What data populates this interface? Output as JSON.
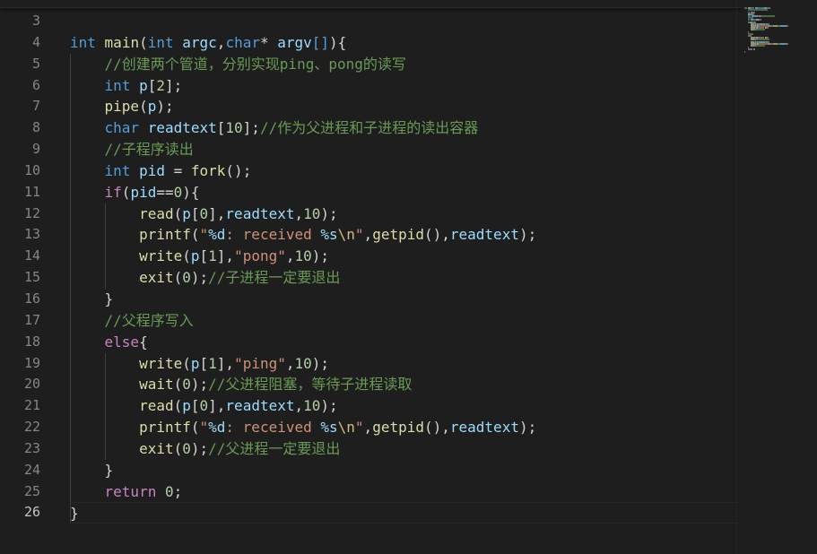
{
  "editor": {
    "active_line": "26",
    "lines": [
      {
        "n": "3",
        "tokens": []
      },
      {
        "n": "4",
        "tokens": [
          {
            "t": "int",
            "c": "kw"
          },
          {
            "t": " ",
            "c": "pl"
          },
          {
            "t": "main",
            "c": "fn"
          },
          {
            "t": "(",
            "c": "pl"
          },
          {
            "t": "int",
            "c": "kw"
          },
          {
            "t": " ",
            "c": "pl"
          },
          {
            "t": "argc",
            "c": "var"
          },
          {
            "t": ",",
            "c": "pl"
          },
          {
            "t": "char",
            "c": "kw"
          },
          {
            "t": "* ",
            "c": "pl"
          },
          {
            "t": "argv",
            "c": "var"
          },
          {
            "t": "[]",
            "c": "kw"
          },
          {
            "t": "){",
            "c": "pl"
          }
        ]
      },
      {
        "n": "5",
        "tokens": [
          {
            "t": "    ",
            "c": "pl"
          },
          {
            "t": "//创建两个管道，分别实现ping、pong的读写",
            "c": "cm"
          }
        ]
      },
      {
        "n": "6",
        "tokens": [
          {
            "t": "    ",
            "c": "pl"
          },
          {
            "t": "int",
            "c": "kw"
          },
          {
            "t": " ",
            "c": "pl"
          },
          {
            "t": "p",
            "c": "var"
          },
          {
            "t": "[",
            "c": "pl"
          },
          {
            "t": "2",
            "c": "num"
          },
          {
            "t": "];",
            "c": "pl"
          }
        ]
      },
      {
        "n": "7",
        "tokens": [
          {
            "t": "    ",
            "c": "pl"
          },
          {
            "t": "pipe",
            "c": "fn"
          },
          {
            "t": "(",
            "c": "pl"
          },
          {
            "t": "p",
            "c": "var"
          },
          {
            "t": ");",
            "c": "pl"
          }
        ]
      },
      {
        "n": "8",
        "tokens": [
          {
            "t": "    ",
            "c": "pl"
          },
          {
            "t": "char",
            "c": "kw"
          },
          {
            "t": " ",
            "c": "pl"
          },
          {
            "t": "readtext",
            "c": "var"
          },
          {
            "t": "[",
            "c": "pl"
          },
          {
            "t": "10",
            "c": "num"
          },
          {
            "t": "];",
            "c": "pl"
          },
          {
            "t": "//作为父进程和子进程的读出容器",
            "c": "cm"
          }
        ]
      },
      {
        "n": "9",
        "tokens": [
          {
            "t": "    ",
            "c": "pl"
          },
          {
            "t": "//子程序读出",
            "c": "cm"
          }
        ]
      },
      {
        "n": "10",
        "tokens": [
          {
            "t": "    ",
            "c": "pl"
          },
          {
            "t": "int",
            "c": "kw"
          },
          {
            "t": " ",
            "c": "pl"
          },
          {
            "t": "pid",
            "c": "var"
          },
          {
            "t": " = ",
            "c": "pl"
          },
          {
            "t": "fork",
            "c": "fn"
          },
          {
            "t": "();",
            "c": "pl"
          }
        ]
      },
      {
        "n": "11",
        "tokens": [
          {
            "t": "    ",
            "c": "pl"
          },
          {
            "t": "if",
            "c": "ctl"
          },
          {
            "t": "(",
            "c": "pl"
          },
          {
            "t": "pid",
            "c": "var"
          },
          {
            "t": "==",
            "c": "pl"
          },
          {
            "t": "0",
            "c": "num"
          },
          {
            "t": "){",
            "c": "pl"
          }
        ]
      },
      {
        "n": "12",
        "tokens": [
          {
            "t": "        ",
            "c": "pl"
          },
          {
            "t": "read",
            "c": "fn"
          },
          {
            "t": "(",
            "c": "pl"
          },
          {
            "t": "p",
            "c": "var"
          },
          {
            "t": "[",
            "c": "pl"
          },
          {
            "t": "0",
            "c": "num"
          },
          {
            "t": "],",
            "c": "pl"
          },
          {
            "t": "readtext",
            "c": "var"
          },
          {
            "t": ",",
            "c": "pl"
          },
          {
            "t": "10",
            "c": "num"
          },
          {
            "t": ");",
            "c": "pl"
          }
        ]
      },
      {
        "n": "13",
        "tokens": [
          {
            "t": "        ",
            "c": "pl"
          },
          {
            "t": "printf",
            "c": "fn"
          },
          {
            "t": "(",
            "c": "pl"
          },
          {
            "t": "\"",
            "c": "str"
          },
          {
            "t": "%d",
            "c": "var"
          },
          {
            "t": ": received ",
            "c": "str"
          },
          {
            "t": "%s",
            "c": "var"
          },
          {
            "t": "\\n",
            "c": "esc"
          },
          {
            "t": "\"",
            "c": "str"
          },
          {
            "t": ",",
            "c": "pl"
          },
          {
            "t": "getpid",
            "c": "fn"
          },
          {
            "t": "(),",
            "c": "pl"
          },
          {
            "t": "readtext",
            "c": "var"
          },
          {
            "t": ");",
            "c": "pl"
          }
        ]
      },
      {
        "n": "14",
        "tokens": [
          {
            "t": "        ",
            "c": "pl"
          },
          {
            "t": "write",
            "c": "fn"
          },
          {
            "t": "(",
            "c": "pl"
          },
          {
            "t": "p",
            "c": "var"
          },
          {
            "t": "[",
            "c": "pl"
          },
          {
            "t": "1",
            "c": "num"
          },
          {
            "t": "],",
            "c": "pl"
          },
          {
            "t": "\"pong\"",
            "c": "str"
          },
          {
            "t": ",",
            "c": "pl"
          },
          {
            "t": "10",
            "c": "num"
          },
          {
            "t": ");",
            "c": "pl"
          }
        ]
      },
      {
        "n": "15",
        "tokens": [
          {
            "t": "        ",
            "c": "pl"
          },
          {
            "t": "exit",
            "c": "fn"
          },
          {
            "t": "(",
            "c": "pl"
          },
          {
            "t": "0",
            "c": "num"
          },
          {
            "t": ");",
            "c": "pl"
          },
          {
            "t": "//子进程一定要退出",
            "c": "cm"
          }
        ]
      },
      {
        "n": "16",
        "tokens": [
          {
            "t": "    ",
            "c": "pl"
          },
          {
            "t": "}",
            "c": "pl"
          }
        ]
      },
      {
        "n": "17",
        "tokens": [
          {
            "t": "    ",
            "c": "pl"
          },
          {
            "t": "//父程序写入",
            "c": "cm"
          }
        ]
      },
      {
        "n": "18",
        "tokens": [
          {
            "t": "    ",
            "c": "pl"
          },
          {
            "t": "else",
            "c": "ctl"
          },
          {
            "t": "{",
            "c": "pl"
          }
        ]
      },
      {
        "n": "19",
        "tokens": [
          {
            "t": "        ",
            "c": "pl"
          },
          {
            "t": "write",
            "c": "fn"
          },
          {
            "t": "(",
            "c": "pl"
          },
          {
            "t": "p",
            "c": "var"
          },
          {
            "t": "[",
            "c": "pl"
          },
          {
            "t": "1",
            "c": "num"
          },
          {
            "t": "],",
            "c": "pl"
          },
          {
            "t": "\"ping\"",
            "c": "str"
          },
          {
            "t": ",",
            "c": "pl"
          },
          {
            "t": "10",
            "c": "num"
          },
          {
            "t": ");",
            "c": "pl"
          }
        ]
      },
      {
        "n": "20",
        "tokens": [
          {
            "t": "        ",
            "c": "pl"
          },
          {
            "t": "wait",
            "c": "fn"
          },
          {
            "t": "(",
            "c": "pl"
          },
          {
            "t": "0",
            "c": "num"
          },
          {
            "t": ");",
            "c": "pl"
          },
          {
            "t": "//父进程阻塞，等待子进程读取",
            "c": "cm"
          }
        ]
      },
      {
        "n": "21",
        "tokens": [
          {
            "t": "        ",
            "c": "pl"
          },
          {
            "t": "read",
            "c": "fn"
          },
          {
            "t": "(",
            "c": "pl"
          },
          {
            "t": "p",
            "c": "var"
          },
          {
            "t": "[",
            "c": "pl"
          },
          {
            "t": "0",
            "c": "num"
          },
          {
            "t": "],",
            "c": "pl"
          },
          {
            "t": "readtext",
            "c": "var"
          },
          {
            "t": ",",
            "c": "pl"
          },
          {
            "t": "10",
            "c": "num"
          },
          {
            "t": ");",
            "c": "pl"
          }
        ]
      },
      {
        "n": "22",
        "tokens": [
          {
            "t": "        ",
            "c": "pl"
          },
          {
            "t": "printf",
            "c": "fn"
          },
          {
            "t": "(",
            "c": "pl"
          },
          {
            "t": "\"",
            "c": "str"
          },
          {
            "t": "%d",
            "c": "var"
          },
          {
            "t": ": received ",
            "c": "str"
          },
          {
            "t": "%s",
            "c": "var"
          },
          {
            "t": "\\n",
            "c": "esc"
          },
          {
            "t": "\"",
            "c": "str"
          },
          {
            "t": ",",
            "c": "pl"
          },
          {
            "t": "getpid",
            "c": "fn"
          },
          {
            "t": "(),",
            "c": "pl"
          },
          {
            "t": "readtext",
            "c": "var"
          },
          {
            "t": ");",
            "c": "pl"
          }
        ]
      },
      {
        "n": "23",
        "tokens": [
          {
            "t": "        ",
            "c": "pl"
          },
          {
            "t": "exit",
            "c": "fn"
          },
          {
            "t": "(",
            "c": "pl"
          },
          {
            "t": "0",
            "c": "num"
          },
          {
            "t": ");",
            "c": "pl"
          },
          {
            "t": "//父进程一定要退出",
            "c": "cm"
          }
        ]
      },
      {
        "n": "24",
        "tokens": [
          {
            "t": "    ",
            "c": "pl"
          },
          {
            "t": "}",
            "c": "pl"
          }
        ]
      },
      {
        "n": "25",
        "tokens": [
          {
            "t": "    ",
            "c": "pl"
          },
          {
            "t": "return",
            "c": "ctl"
          },
          {
            "t": " ",
            "c": "pl"
          },
          {
            "t": "0",
            "c": "num"
          },
          {
            "t": ";",
            "c": "pl"
          }
        ]
      },
      {
        "n": "26",
        "tokens": [
          {
            "t": "}",
            "c": "pl"
          }
        ]
      }
    ]
  }
}
